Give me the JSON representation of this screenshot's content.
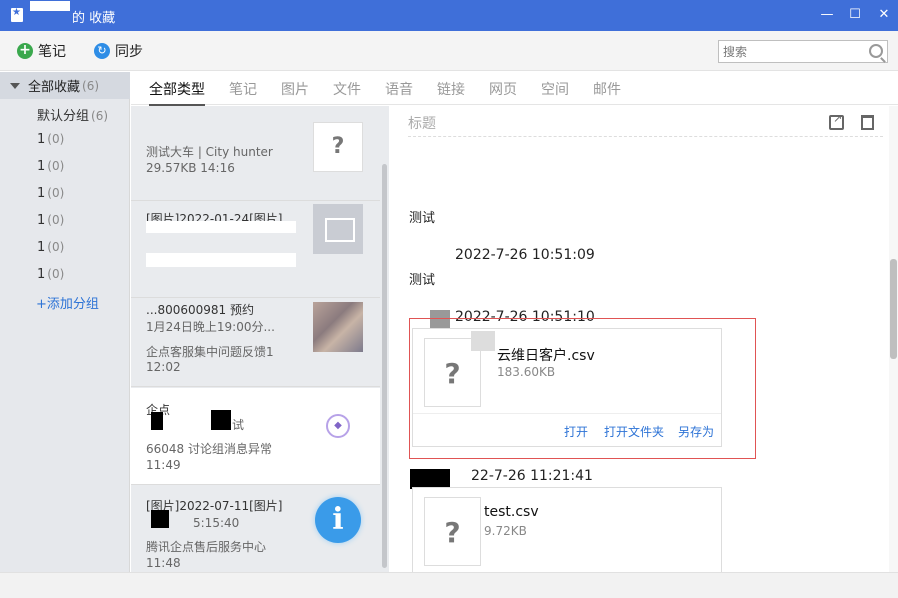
{
  "window": {
    "title": "的 收藏"
  },
  "toolbar": {
    "note_label": "笔记",
    "sync_label": "同步",
    "search_placeholder": "搜索"
  },
  "sidebar": {
    "root": {
      "label": "全部收藏",
      "count": "(6)"
    },
    "groups": [
      {
        "label": "默认分组",
        "count": "(6)"
      },
      {
        "label": "1",
        "count": "(0)"
      },
      {
        "label": "1",
        "count": "(0)"
      },
      {
        "label": "1",
        "count": "(0)"
      },
      {
        "label": "1",
        "count": "(0)"
      },
      {
        "label": "1",
        "count": "(0)"
      },
      {
        "label": "1",
        "count": "(0)"
      }
    ],
    "add_group": "+添加分组"
  },
  "tabs": [
    "全部类型",
    "笔记",
    "图片",
    "文件",
    "语音",
    "链接",
    "网页",
    "空间",
    "邮件"
  ],
  "list": [
    {
      "title": "",
      "sub": "测试大车 | City hunter",
      "meta": "29.57KB 14:16",
      "thumb": "question"
    },
    {
      "title": "[图片]2022-01-24[图片]",
      "sub": "",
      "meta": "",
      "thumb": "image"
    },
    {
      "title": "...800600981 预约",
      "sub": "1月24日晚上19:00分...",
      "meta": "企点客服集中问题反馈1",
      "meta2": "12:02",
      "thumb": "photo"
    },
    {
      "title": "企点",
      "sub": "试",
      "meta": "66048 讨论组消息异常",
      "meta2": "11:49",
      "thumb": "logo"
    },
    {
      "title": "[图片]2022-07-11[图片]",
      "sub": "5:15:40",
      "meta": "腾讯企点售后服务中心",
      "meta2": "11:48",
      "thumb": "info"
    }
  ],
  "detail": {
    "title_placeholder": "标题",
    "text1": "测试",
    "time1": "2022-7-26 10:51:09",
    "text2": "测试",
    "time2": "2022-7-26 10:51:10",
    "file1": {
      "name": "云维日客户.csv",
      "size": "183.60KB"
    },
    "file_actions": {
      "open": "打开",
      "open_folder": "打开文件夹",
      "save_as": "另存为"
    },
    "time3": "22-7-26 11:21:41",
    "file2": {
      "name": "test.csv",
      "size": "9.72KB"
    }
  }
}
